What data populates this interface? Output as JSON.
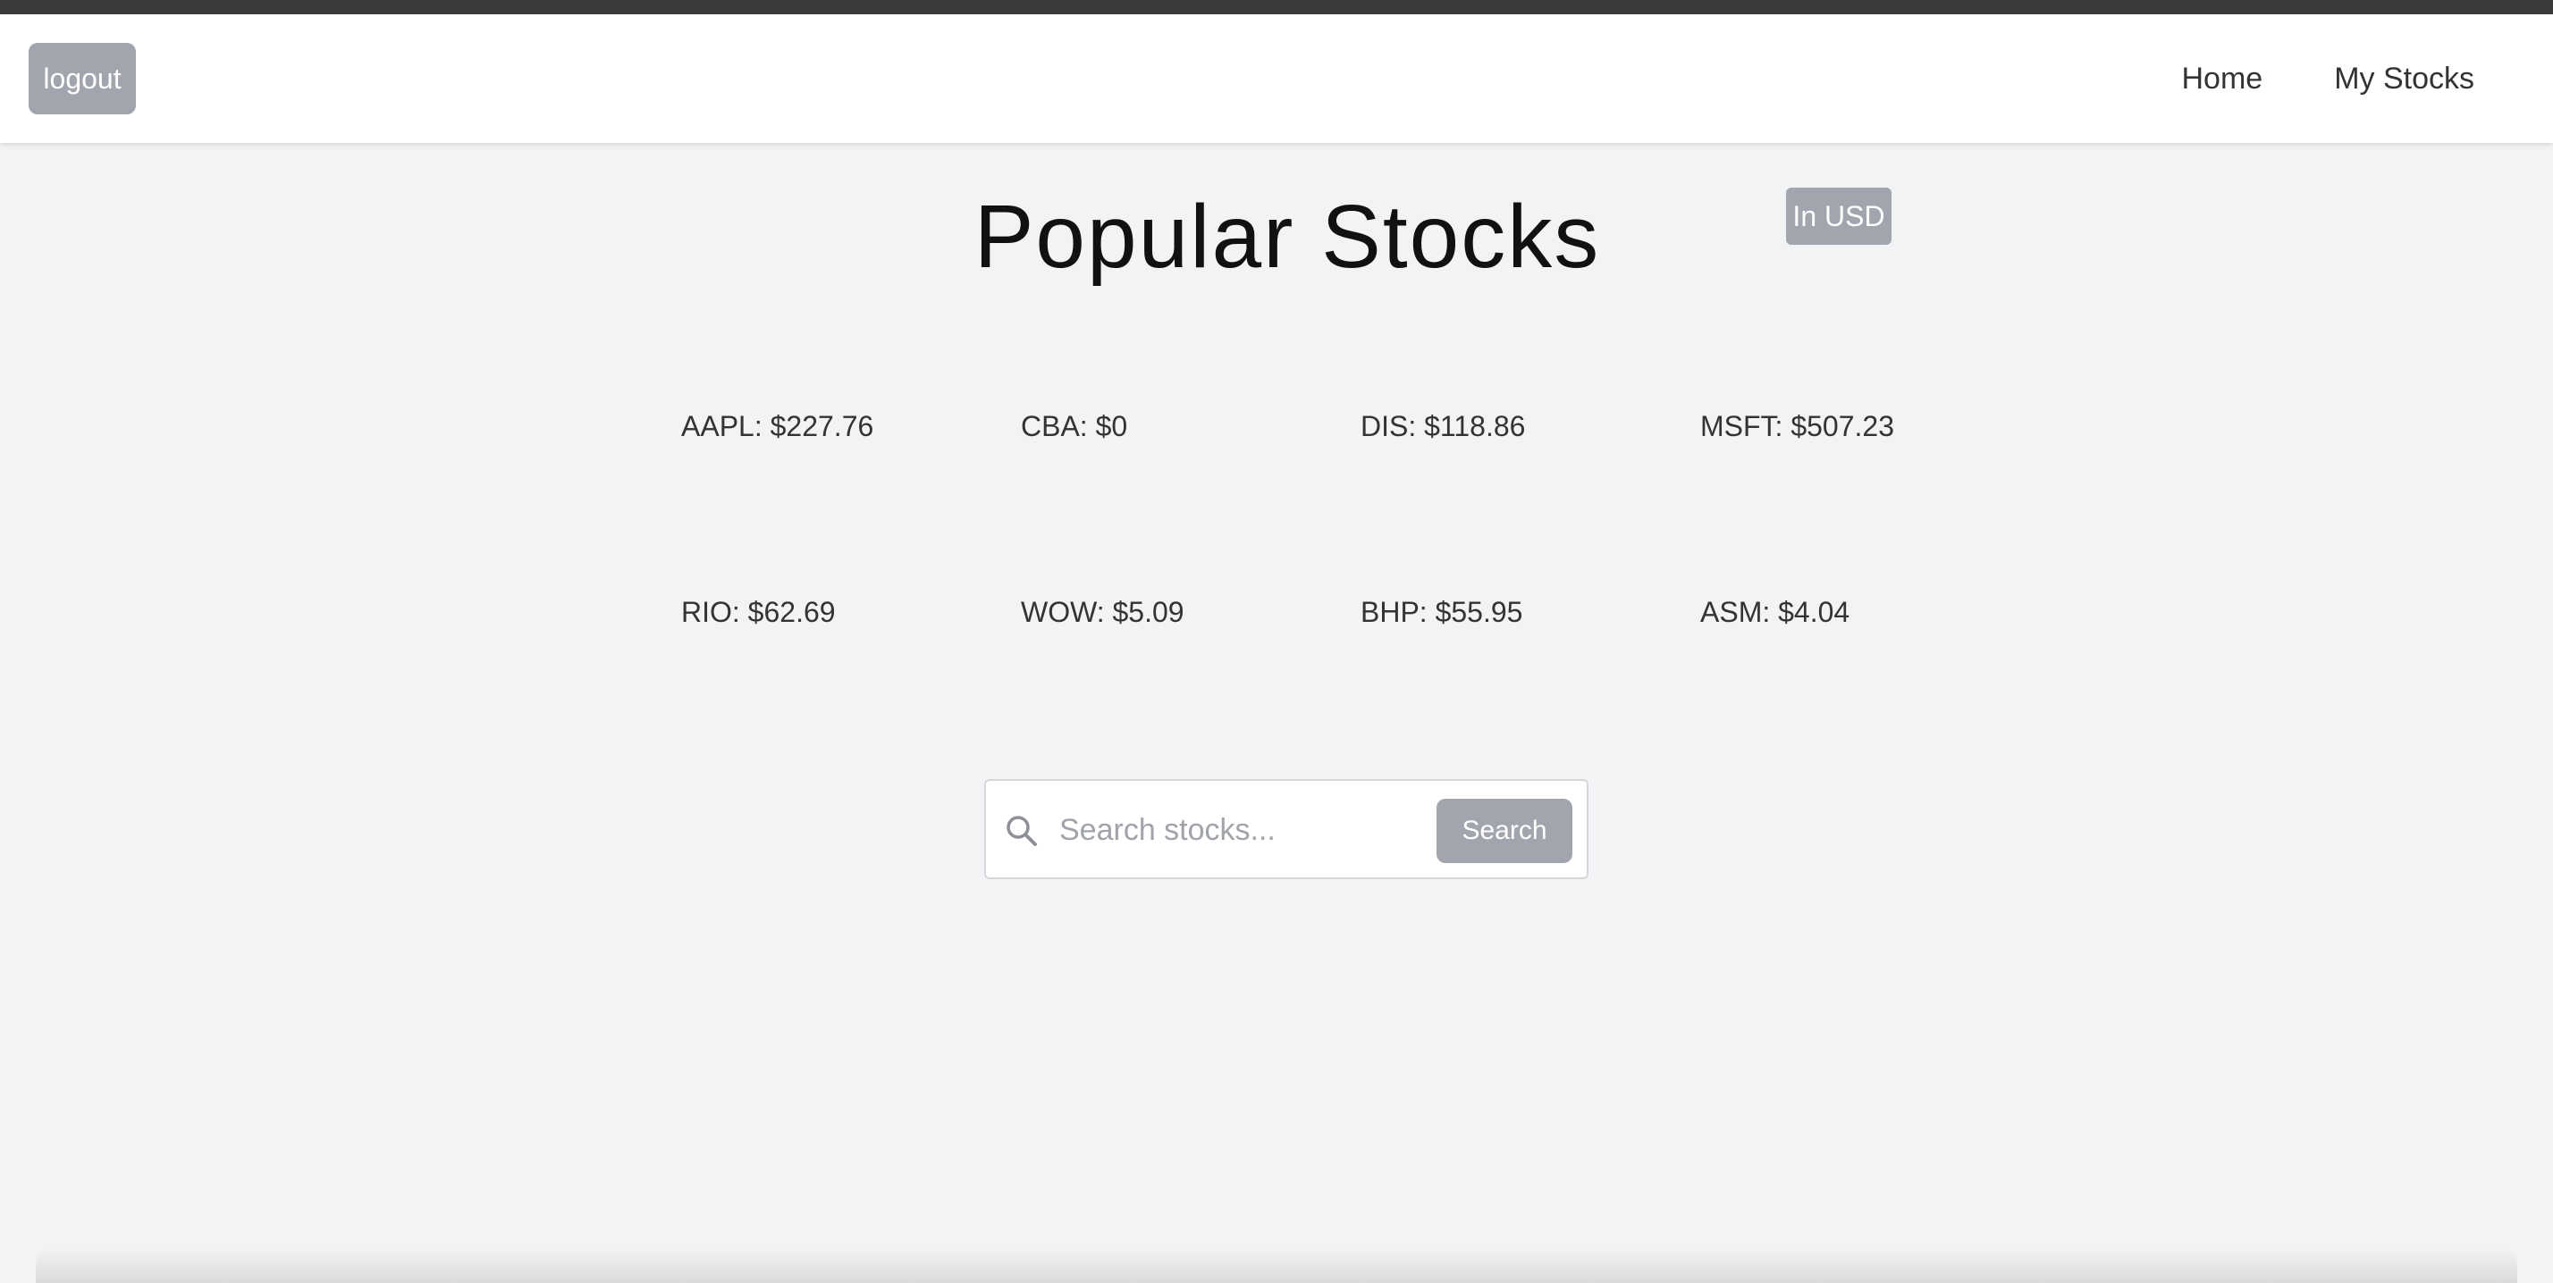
{
  "header": {
    "logout_label": "logout",
    "nav": [
      {
        "label": "Home"
      },
      {
        "label": "My Stocks"
      }
    ]
  },
  "main": {
    "title": "Popular Stocks",
    "currency_badge": "In USD",
    "stocks": [
      {
        "label": "AAPL: $227.76"
      },
      {
        "label": "CBA: $0"
      },
      {
        "label": "DIS: $118.86"
      },
      {
        "label": "MSFT: $507.23"
      },
      {
        "label": "RIO: $62.69"
      },
      {
        "label": "WOW: $5.09"
      },
      {
        "label": "BHP: $55.95"
      },
      {
        "label": "ASM: $4.04"
      }
    ]
  },
  "search": {
    "placeholder": "Search stocks...",
    "value": "",
    "button_label": "Search",
    "icon": "search-icon"
  },
  "colors": {
    "background": "#f2f3f5",
    "navbar": "#ffffff",
    "button_gray": "#a2a5ad",
    "top_strip": "#3a3b3d"
  }
}
